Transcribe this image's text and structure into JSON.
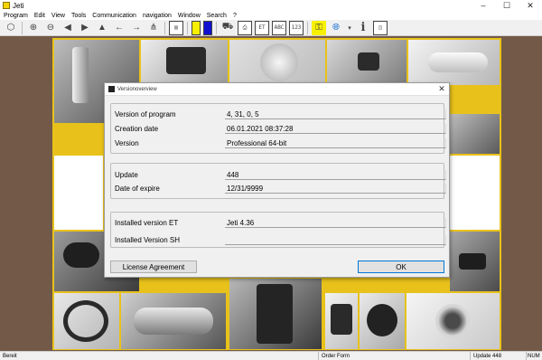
{
  "window": {
    "title": "Jeti",
    "minimize": "–",
    "maximize": "☐",
    "close": "✕"
  },
  "menu": [
    "Program",
    "Edit",
    "View",
    "Tools",
    "Communication",
    "navigation",
    "Window",
    "Search",
    "?"
  ],
  "toolbar": {
    "et_label": "ET",
    "abc_label": "ABC",
    "num_label": "123",
    "info_label": "i"
  },
  "dialog": {
    "title": "Versionoverview",
    "close": "✕",
    "groups": [
      {
        "rows": [
          {
            "label": "Version of program",
            "value": "4, 31, 0, 5"
          },
          {
            "label": "Creation date",
            "value": "06.01.2021 08:37:28"
          },
          {
            "label": "Version",
            "value": "Professional 64-bit"
          }
        ]
      },
      {
        "rows": [
          {
            "label": "Update",
            "value": "448"
          },
          {
            "label": "Date of expire",
            "value": "12/31/9999"
          }
        ]
      },
      {
        "rows": [
          {
            "label": "Installed version ET",
            "value": "Jeti 4.36"
          },
          {
            "label": "Installed Version SH",
            "value": ""
          }
        ]
      }
    ],
    "license_button": "License Agreement",
    "ok_button": "OK"
  },
  "status": {
    "left": "Bereit",
    "middle": "Order Form",
    "update": "Update 448",
    "num": "NUM"
  }
}
